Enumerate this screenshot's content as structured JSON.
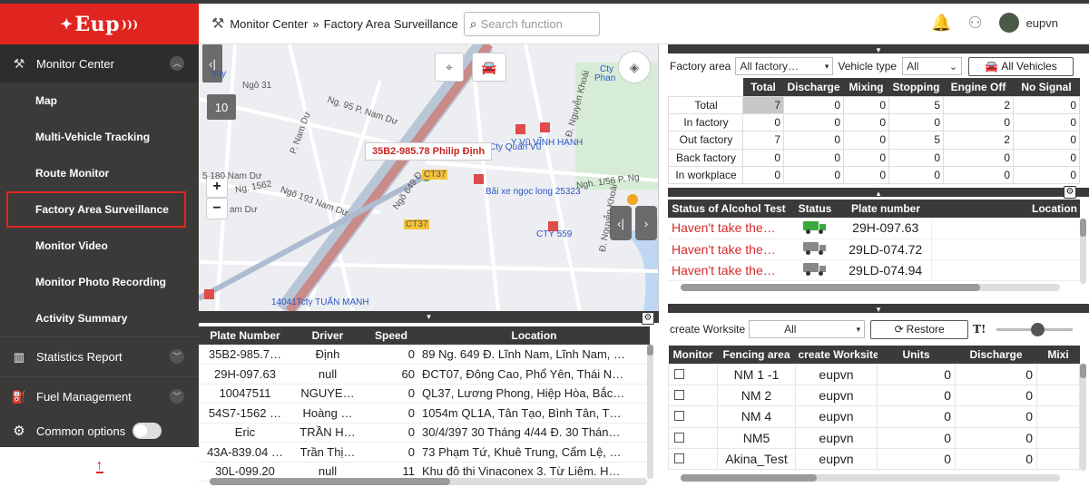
{
  "app": {
    "logo_text": "Eup",
    "brand_color": "#e0241f"
  },
  "sidebar": {
    "monitor_center": "Monitor Center",
    "items": [
      {
        "label": "Map"
      },
      {
        "label": "Multi-Vehicle Tracking"
      },
      {
        "label": "Route Monitor"
      },
      {
        "label": "Factory Area Surveillance"
      },
      {
        "label": "Monitor Video"
      },
      {
        "label": "Monitor Photo Recording"
      },
      {
        "label": "Activity Summary"
      }
    ],
    "statistics_report": "Statistics Report",
    "fuel_management": "Fuel Management",
    "common_options": "Common options"
  },
  "header": {
    "breadcrumb_root": "Monitor Center",
    "breadcrumb_sep": "»",
    "breadcrumb_current": "Factory Area Surveillance",
    "search_placeholder": "Search function",
    "username": "eupvn"
  },
  "map": {
    "zoom_badge": "10",
    "popup_text": "35B2-985.78 Philip  Định",
    "labels": [
      {
        "text": "duy",
        "cls": "blue"
      },
      {
        "text": "Ngõ 31",
        "cls": ""
      },
      {
        "text": "Ng. 95 P. Nam Dư",
        "cls": ""
      },
      {
        "text": "P. Nam Dư",
        "cls": ""
      },
      {
        "text": "Ngõ 193 Nam Dư",
        "cls": ""
      },
      {
        "text": "5 180 Nam Dư",
        "cls": ""
      },
      {
        "text": "Ng. 1562",
        "cls": ""
      },
      {
        "text": "am Dư",
        "cls": ""
      },
      {
        "text": "Ngõ 649 Đ.",
        "cls": ""
      },
      {
        "text": "CT37",
        "cls": ""
      },
      {
        "text": "CT37",
        "cls": ""
      },
      {
        "text": "Cty",
        "cls": "blue"
      },
      {
        "text": "Phan",
        "cls": "blue"
      },
      {
        "text": "Cty Quản Vũ",
        "cls": "blue"
      },
      {
        "text": "Y Vũ VĨNH HẠNH",
        "cls": "blue"
      },
      {
        "text": "Bãi xe ngọc long 25323",
        "cls": "blue"
      },
      {
        "text": "CTY 559",
        "cls": "blue"
      },
      {
        "text": "Ngh. 1/56 P. Ng",
        "cls": ""
      },
      {
        "text": "Đ. Nguyễn Khoái",
        "cls": ""
      },
      {
        "text": "Đ. Nguyễn Khoái",
        "cls": ""
      },
      {
        "text": "14041Tcty TUẤN MẠNH",
        "cls": "blue"
      }
    ]
  },
  "vehicle_table": {
    "columns": [
      "Plate Number",
      "Driver",
      "Speed",
      "Location"
    ],
    "rows": [
      {
        "plate": "35B2-985.7…",
        "driver": "Định",
        "speed": "0",
        "location": "89 Ng. 649 Đ. Lĩnh Nam, Lĩnh Nam, …"
      },
      {
        "plate": "29H-097.63",
        "driver": "null",
        "speed": "60",
        "location": "ĐCT07, Đông Cao, Phổ Yên, Thái N…"
      },
      {
        "plate": "10047511",
        "driver": "NGUYE…",
        "speed": "0",
        "location": "QL37, Lương Phong, Hiệp Hòa, Bắc…"
      },
      {
        "plate": "54S7-1562 …",
        "driver": "Hoàng …",
        "speed": "0",
        "location": "1054m QL1A, Tân Tạo, Bình Tân, T…"
      },
      {
        "plate": "Eric",
        "driver": "TRẦN H…",
        "speed": "0",
        "location": "30/4/397 30 Tháng 4/44 Đ. 30 Thán…"
      },
      {
        "plate": "43A-839.04 …",
        "driver": "Trần Thị…",
        "speed": "0",
        "location": "73 Phạm Tứ, Khuê Trung, Cẩm Lệ, …"
      },
      {
        "plate": "30L-099.20",
        "driver": "null",
        "speed": "11",
        "location": "Khu đô thi Vinaconex 3. Từ Liêm. H…"
      }
    ]
  },
  "filters": {
    "factory_label": "Factory area",
    "factory_value": "All factory…",
    "vehicle_type_label": "Vehicle type",
    "vehicle_type_value": "All",
    "all_vehicles_button": "All Vehicles"
  },
  "summary": {
    "columns": [
      "",
      "Total",
      "Discharge",
      "Mixing",
      "Stopping",
      "Engine Off",
      "No Signal"
    ],
    "rows": [
      {
        "label": "Total",
        "values": [
          "7",
          "0",
          "0",
          "5",
          "2",
          "0"
        ]
      },
      {
        "label": "In factory",
        "values": [
          "0",
          "0",
          "0",
          "0",
          "0",
          "0"
        ]
      },
      {
        "label": "Out factory",
        "values": [
          "7",
          "0",
          "0",
          "5",
          "2",
          "0"
        ]
      },
      {
        "label": "Back factory",
        "values": [
          "0",
          "0",
          "0",
          "0",
          "0",
          "0"
        ]
      },
      {
        "label": "In workplace",
        "values": [
          "0",
          "0",
          "0",
          "0",
          "0",
          "0"
        ]
      }
    ]
  },
  "alcohol": {
    "columns": [
      "Status of Alcohol Test",
      "Status",
      "Plate number",
      "Location"
    ],
    "rows": [
      {
        "status_text": "Haven't take the…",
        "plate": "29H-097.63",
        "truck_color": "#3aa83a"
      },
      {
        "status_text": "Haven't take the…",
        "plate": "29LD-074.72",
        "truck_color": "#888888"
      },
      {
        "status_text": "Haven't take the…",
        "plate": "29LD-074.94",
        "truck_color": "#888888"
      }
    ]
  },
  "worksite": {
    "create_label": "create Worksite",
    "select_value": "All",
    "restore_button": "Restore",
    "columns": [
      "Monitor",
      "Fencing area",
      "create Worksite",
      "Units",
      "Discharge",
      "Mixi"
    ],
    "rows": [
      {
        "area": "NM 1 -1",
        "creator": "eupvn",
        "units": "0",
        "discharge": "0"
      },
      {
        "area": "NM 2",
        "creator": "eupvn",
        "units": "0",
        "discharge": "0"
      },
      {
        "area": "NM 4",
        "creator": "eupvn",
        "units": "0",
        "discharge": "0"
      },
      {
        "area": "NM5",
        "creator": "eupvn",
        "units": "0",
        "discharge": "0"
      },
      {
        "area": "Akina_Test",
        "creator": "eupvn",
        "units": "0",
        "discharge": "0"
      }
    ]
  }
}
